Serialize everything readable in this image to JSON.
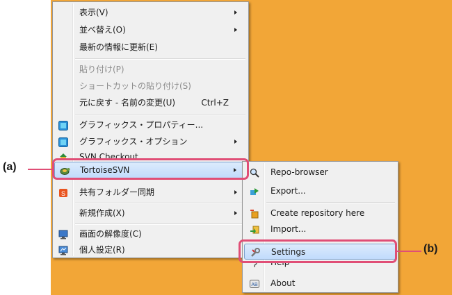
{
  "context_menu": {
    "items": [
      {
        "label": "表示(V)"
      },
      {
        "label": "並べ替え(O)"
      },
      {
        "label": "最新の情報に更新(E)"
      },
      {
        "label": "貼り付け(P)"
      },
      {
        "label": "ショートカットの貼り付け(S)"
      },
      {
        "label": "元に戻す - 名前の変更(U)",
        "shortcut": "Ctrl+Z"
      },
      {
        "label": "グラフィックス・プロパティー..."
      },
      {
        "label": "グラフィックス・オプション"
      },
      {
        "label": "SVN Checkout..."
      },
      {
        "label": "TortoiseSVN"
      },
      {
        "label": "共有フォルダー同期"
      },
      {
        "label": "新規作成(X)"
      },
      {
        "label": "画面の解像度(C)"
      },
      {
        "label": "個人設定(R)"
      }
    ]
  },
  "submenu": {
    "items": [
      {
        "label": "Repo-browser"
      },
      {
        "label": "Export..."
      },
      {
        "label": "Create repository here"
      },
      {
        "label": "Import..."
      },
      {
        "label": "Settings"
      },
      {
        "label": "Help"
      },
      {
        "label": "About"
      }
    ]
  },
  "callouts": {
    "a": "(a)",
    "b": "(b)"
  },
  "colors": {
    "desktop": "#f2a637",
    "highlight_border": "#e04e76",
    "menu_bg": "#f0f0f0",
    "selection": "#c1dbfc"
  }
}
